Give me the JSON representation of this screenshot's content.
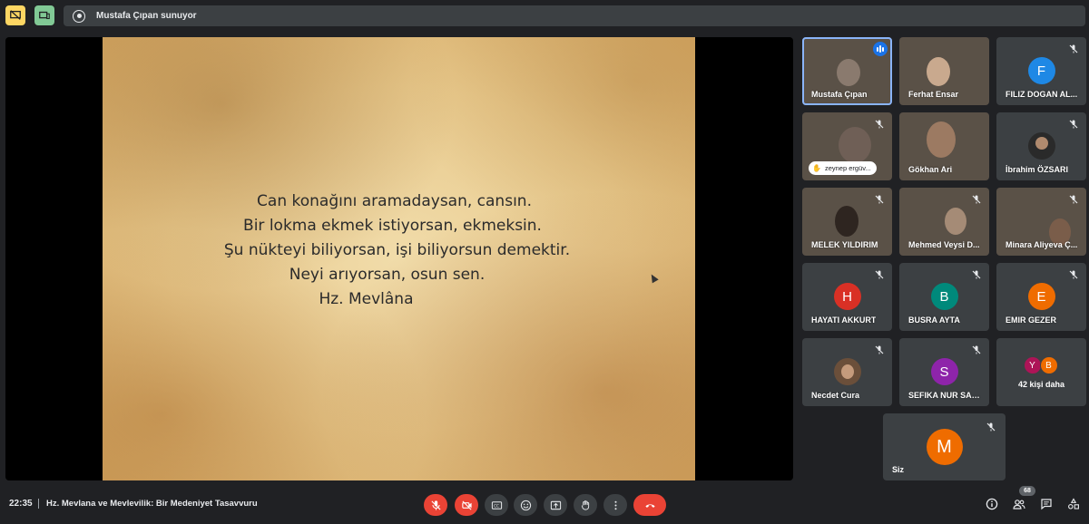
{
  "topbar": {
    "presenter_text": "Mustafa Çıpan sunuyor",
    "colors": {
      "btn1": "#fdd663",
      "btn2": "#81c995",
      "bar": "#3c4043"
    }
  },
  "slide": {
    "lines": [
      "Can konağını aramadaysan, cansın.",
      "Bir lokma ekmek istiyorsan, ekmeksin.",
      "Şu nükteyi biliyorsan, işi biliyorsun demektir.",
      "Neyi arıyorsan, osun sen.",
      "Hz. Mevlâna"
    ]
  },
  "participants": [
    {
      "name": "Mustafa Çıpan",
      "type": "video",
      "speaking": true
    },
    {
      "name": "Ferhat Ensar",
      "type": "video",
      "muted": false
    },
    {
      "name": "FILIZ DOGAN AL...",
      "type": "avatar",
      "initial": "F",
      "color": "#1e88e5",
      "muted": true
    },
    {
      "name": "zeynep ergüv...",
      "type": "video",
      "muted": true,
      "hand_raised": true
    },
    {
      "name": "Gökhan Ari",
      "type": "video",
      "muted": false
    },
    {
      "name": "İbrahim ÖZSARI",
      "type": "photo",
      "muted": true
    },
    {
      "name": "MELEK YILDIRIM",
      "type": "video",
      "muted": true
    },
    {
      "name": "Mehmed Veysi D...",
      "type": "video",
      "muted": true
    },
    {
      "name": "Minara Aliyeva Ç...",
      "type": "video",
      "muted": true
    },
    {
      "name": "HAYATI AKKURT",
      "type": "avatar",
      "initial": "H",
      "color": "#d93025",
      "muted": true
    },
    {
      "name": "BUSRA AYTA",
      "type": "avatar",
      "initial": "B",
      "color": "#00897b",
      "muted": true
    },
    {
      "name": "EMIR GEZER",
      "type": "avatar",
      "initial": "E",
      "color": "#ef6c00",
      "muted": true
    },
    {
      "name": "Necdet Cura",
      "type": "photo",
      "muted": true
    },
    {
      "name": "SEFIKA NUR SAG...",
      "type": "avatar",
      "initial": "S",
      "color": "#8e24aa",
      "muted": true
    }
  ],
  "more": {
    "text": "42 kişi daha",
    "a1": "Y",
    "a1_color": "#ad1457",
    "a2": "B",
    "a2_color": "#ef6c00"
  },
  "self": {
    "name": "Siz",
    "initial": "M",
    "color": "#ef6c00"
  },
  "bottombar": {
    "time": "22:35",
    "meeting_title": "Hz. Mevlana ve Mevlevilik: Bir Medeniyet Tasavvuru",
    "participant_count": "68",
    "controls": [
      "mic-off",
      "camera-off",
      "captions",
      "emoji",
      "present",
      "raise-hand",
      "more",
      "end-call"
    ],
    "right_icons": [
      "info",
      "people",
      "chat",
      "activities"
    ]
  }
}
